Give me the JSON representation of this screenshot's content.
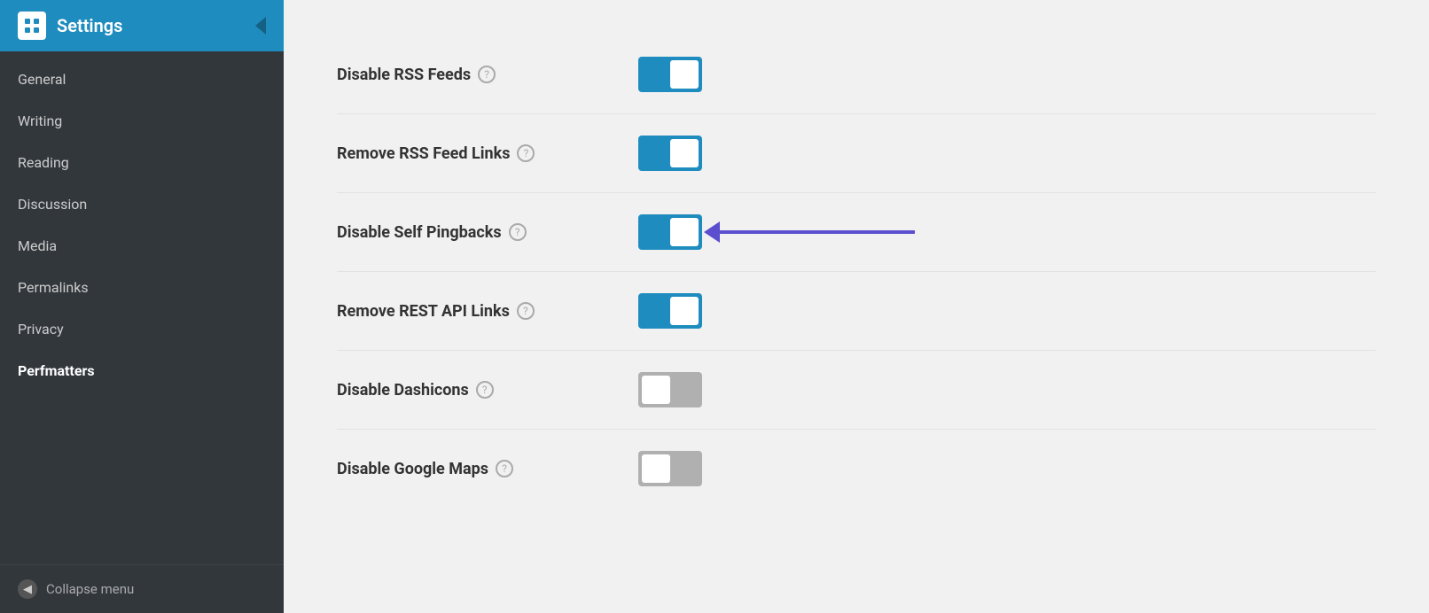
{
  "sidebar": {
    "header": {
      "title": "Settings",
      "icon_label": "wordpress-icon"
    },
    "nav_items": [
      {
        "id": "general",
        "label": "General",
        "active": false
      },
      {
        "id": "writing",
        "label": "Writing",
        "active": false
      },
      {
        "id": "reading",
        "label": "Reading",
        "active": false
      },
      {
        "id": "discussion",
        "label": "Discussion",
        "active": false
      },
      {
        "id": "media",
        "label": "Media",
        "active": false
      },
      {
        "id": "permalinks",
        "label": "Permalinks",
        "active": false
      },
      {
        "id": "privacy",
        "label": "Privacy",
        "active": false
      },
      {
        "id": "perfmatters",
        "label": "Perfmatters",
        "active": true
      }
    ],
    "collapse_label": "Collapse menu"
  },
  "settings": {
    "rows": [
      {
        "id": "disable-rss-feeds",
        "label": "Disable RSS Feeds",
        "state": "on",
        "has_help": true,
        "has_arrow": false
      },
      {
        "id": "remove-rss-feed-links",
        "label": "Remove RSS Feed Links",
        "state": "on",
        "has_help": true,
        "has_arrow": false
      },
      {
        "id": "disable-self-pingbacks",
        "label": "Disable Self Pingbacks",
        "state": "on",
        "has_help": true,
        "has_arrow": true
      },
      {
        "id": "remove-rest-api-links",
        "label": "Remove REST API Links",
        "state": "on",
        "has_help": true,
        "has_arrow": false
      },
      {
        "id": "disable-dashicons",
        "label": "Disable Dashicons",
        "state": "off",
        "has_help": true,
        "has_arrow": false
      },
      {
        "id": "disable-google-maps",
        "label": "Disable Google Maps",
        "state": "off",
        "has_help": true,
        "has_arrow": false
      }
    ]
  },
  "icons": {
    "help": "?",
    "collapse_arrow": "◀"
  }
}
